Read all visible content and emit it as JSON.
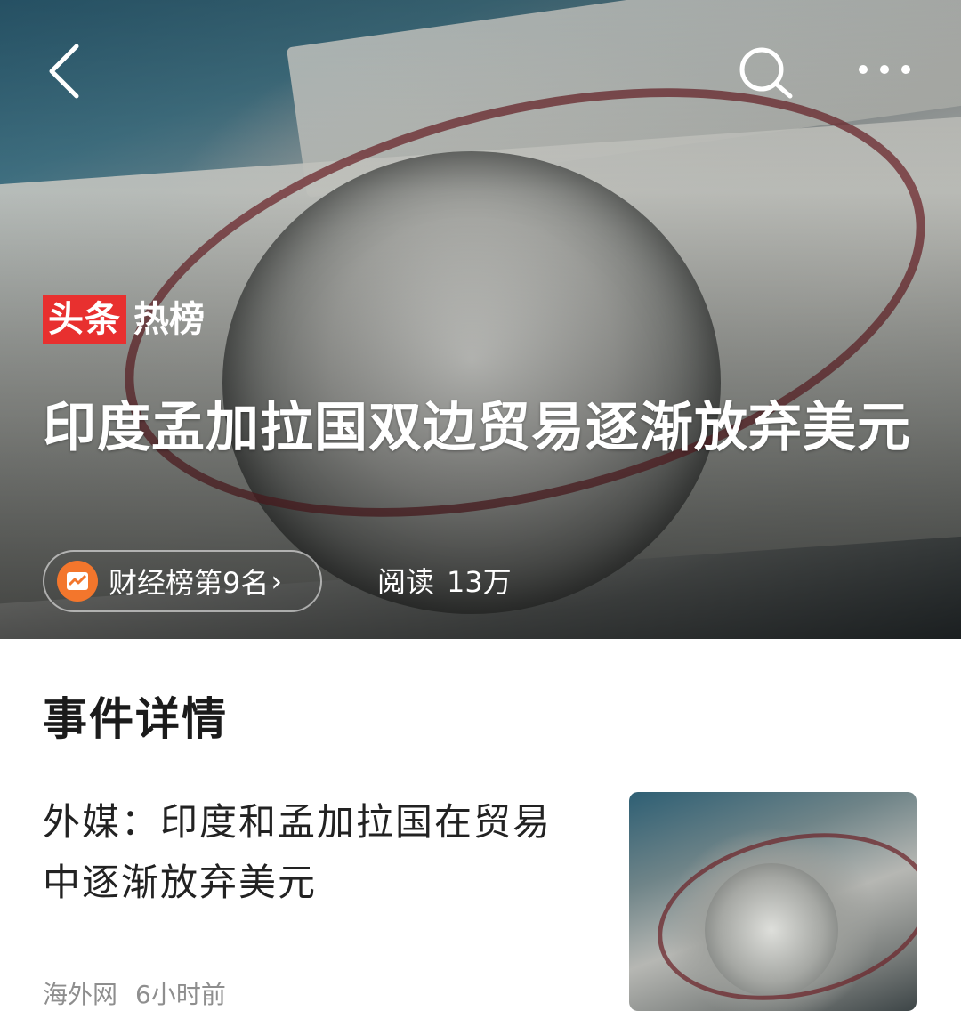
{
  "header": {
    "back_icon": "chevron-left-icon",
    "search_icon": "search-icon",
    "more_icon": "more-horizontal-icon"
  },
  "hero": {
    "brand_red": "头条",
    "brand_white": "热榜",
    "title": "印度孟加拉国双边贸易逐渐放弃美元",
    "rank_label": "财经榜第9名",
    "rank_chevron": "›",
    "reads_label": "阅读",
    "reads_value": "13万"
  },
  "details": {
    "section_title": "事件详情",
    "article_title": "外媒：印度和孟加拉国在贸易中逐渐放弃美元",
    "source": "海外网",
    "time": "6小时前"
  },
  "colors": {
    "brand_red": "#e8302f",
    "rank_icon_orange": "#f3762c",
    "meta_gray": "#8e8e8e"
  }
}
